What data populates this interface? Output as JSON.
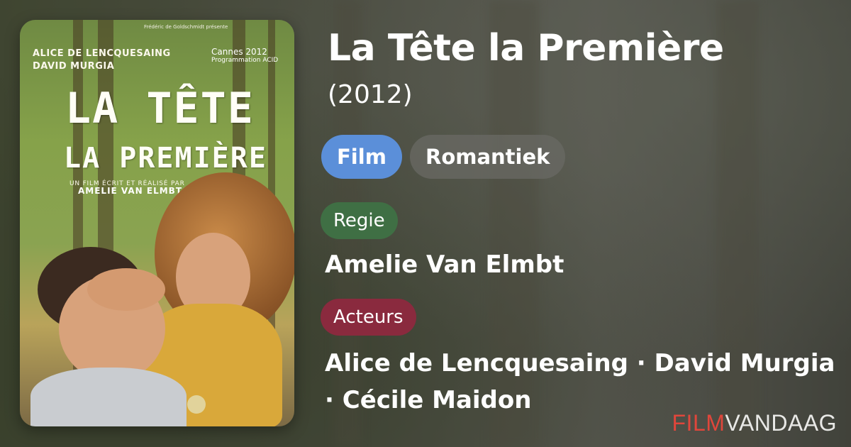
{
  "movie": {
    "title": "La Tête la Première",
    "year": "(2012)"
  },
  "tags": {
    "type": "Film",
    "genre": "Romantiek"
  },
  "regie": {
    "label": "Regie",
    "name": "Amelie Van Elmbt"
  },
  "acteurs": {
    "label": "Acteurs",
    "line1": "Alice de Lencquesaing · David Murgia",
    "line2": "· Cécile Maidon"
  },
  "poster": {
    "presents": "Frédéric de Goldschmidt présente",
    "actor1": "ALICE DE LENCQUESAING",
    "actor2": "DAVID MURGIA",
    "festival": "Cannes 2012",
    "festival_sub": "Programmation ACID",
    "title_line1": "LA TÊTE",
    "title_line2": "LA PREMIÈRE",
    "byline": "UN FILM ÉCRIT ET RÉALISÉ PAR",
    "director": "AMELIE VAN ELMBT"
  },
  "brand": {
    "part1": "FILM",
    "part2": "VANDAAG"
  },
  "colors": {
    "film_pill": "#5b8fd9",
    "regie_label": "#3f6f44",
    "acteurs_label": "#8a2a3e",
    "brand_red": "#e0463b"
  }
}
